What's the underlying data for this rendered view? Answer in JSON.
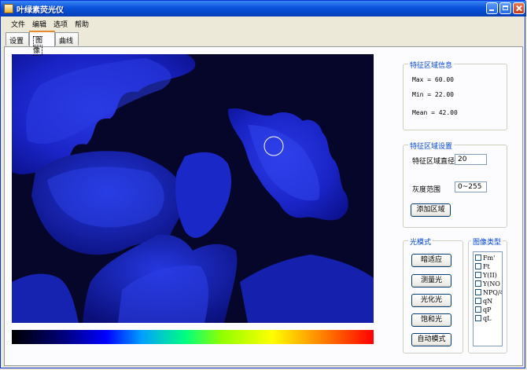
{
  "window": {
    "title": "叶绿素荧光仪"
  },
  "menu": [
    "文件",
    "编辑",
    "选项",
    "帮助"
  ],
  "tabs": [
    {
      "label": "设置",
      "active": false
    },
    {
      "label": "图像",
      "active": true
    },
    {
      "label": "曲线",
      "active": false
    }
  ],
  "feature_info": {
    "title": "特征区域信息",
    "max": "Max = 60.00",
    "min": "Min = 22.00",
    "mean": "Mean = 42.00"
  },
  "feature_settings": {
    "title": "特征区域设置",
    "diameter_label": "特征区域直径",
    "diameter_value": "20",
    "gray_label": "灰度范围",
    "gray_value": "0~255",
    "add_button": "添加区域"
  },
  "light_mode": {
    "title": "光模式",
    "buttons": [
      "暗适应",
      "测量光",
      "光化光",
      "饱和光",
      "自动模式"
    ]
  },
  "image_types": {
    "title": "图像类型",
    "items": [
      "Fm'",
      "Ft",
      "Y(II)",
      "Y(NO",
      "NPQ/4",
      "qN",
      "qP",
      "qL"
    ],
    "checked": [
      false,
      false,
      false,
      false,
      false,
      false,
      false,
      false
    ]
  },
  "colors": {
    "titlebar": "#0a52db",
    "accent": "#0046d5",
    "image_bg": "#06062a",
    "leaf": "#1a2acf"
  }
}
